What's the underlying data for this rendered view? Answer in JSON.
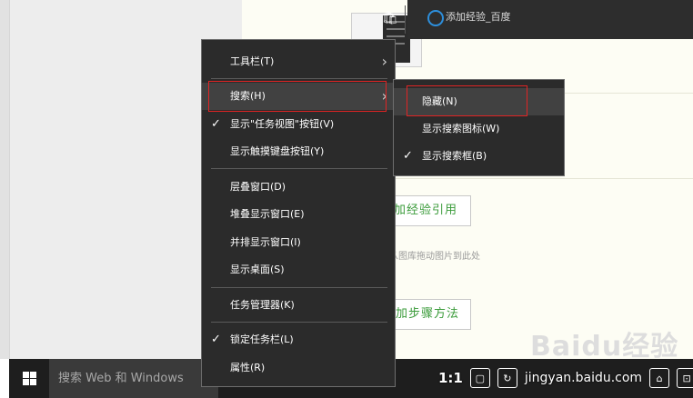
{
  "page": {
    "cite_button": "添加经验引用",
    "cite_button_visible": "加经验引用",
    "drag_hint": "或从图库拖动图片到此处",
    "steps_button": "添加步骤方法",
    "steps_button_visible": "加步骤方法",
    "watermark": "Baidu经验"
  },
  "taskbar": {
    "search_placeholder": "搜索 Web 和 Windows",
    "active_app_title": "添加经验_百度",
    "player": {
      "ratio": "1:1",
      "watermark_text": "jingyan.baidu.com"
    }
  },
  "context_menu": {
    "items": [
      {
        "label": "工具栏(T)",
        "checked": false,
        "submenu": true
      },
      {
        "label": "搜索(H)",
        "checked": false,
        "submenu": true,
        "highlighted": true
      },
      {
        "label": "显示\"任务视图\"按钮(V)",
        "checked": true,
        "submenu": false
      },
      {
        "label": "显示触摸键盘按钮(Y)",
        "checked": false,
        "submenu": false
      },
      {
        "label": "层叠窗口(D)",
        "checked": false,
        "submenu": false
      },
      {
        "label": "堆叠显示窗口(E)",
        "checked": false,
        "submenu": false
      },
      {
        "label": "并排显示窗口(I)",
        "checked": false,
        "submenu": false
      },
      {
        "label": "显示桌面(S)",
        "checked": false,
        "submenu": false
      },
      {
        "label": "任务管理器(K)",
        "checked": false,
        "submenu": false
      },
      {
        "label": "锁定任务栏(L)",
        "checked": true,
        "submenu": false
      },
      {
        "label": "属性(R)",
        "checked": false,
        "submenu": false
      }
    ],
    "check_glyph": "✓",
    "arrow_glyph": "›"
  },
  "search_submenu": {
    "items": [
      {
        "label": "隐藏(N)",
        "checked": false,
        "highlighted": true
      },
      {
        "label": "显示搜索图标(W)",
        "checked": false
      },
      {
        "label": "显示搜索框(B)",
        "checked": true
      }
    ]
  },
  "colors": {
    "menu_bg": "#2b2b2b",
    "highlight_box": "#e02424",
    "taskbar_bg": "#1e1e1e",
    "accent_green": "#3a9b3a"
  }
}
